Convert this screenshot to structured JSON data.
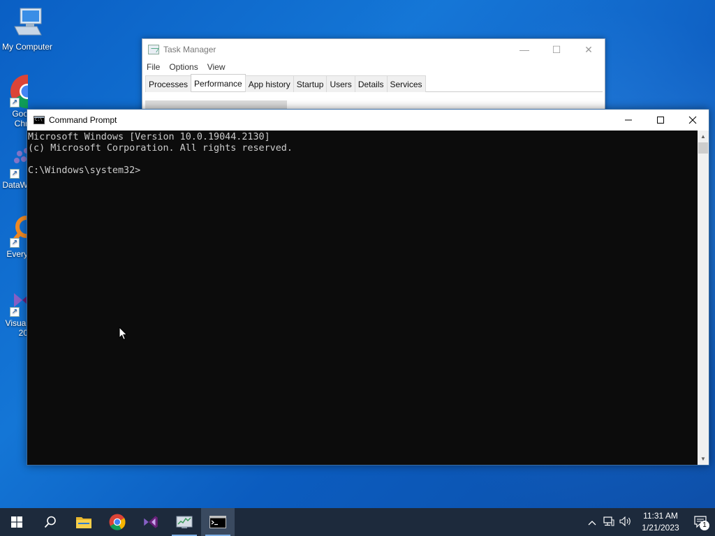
{
  "desktop": {
    "icons": [
      {
        "label": "My Computer"
      },
      {
        "label": "Goo\nChr"
      },
      {
        "label": "DataW"
      },
      {
        "label": "Every"
      },
      {
        "label": "Visual\n20"
      }
    ]
  },
  "task_manager": {
    "title": "Task Manager",
    "menu": [
      "File",
      "Options",
      "View"
    ],
    "tabs": [
      "Processes",
      "Performance",
      "App history",
      "Startup",
      "Users",
      "Details",
      "Services"
    ],
    "active_tab": "Performance",
    "controls": {
      "minimize": "—",
      "maximize": "☐",
      "close": "✕"
    }
  },
  "cmd": {
    "title": "Command Prompt",
    "lines": [
      "Microsoft Windows [Version 10.0.19044.2130]",
      "(c) Microsoft Corporation. All rights reserved.",
      "",
      "C:\\Windows\\system32>"
    ]
  },
  "taskbar": {
    "clock_time": "11:31 AM",
    "clock_date": "1/21/2023",
    "notification_count": "1"
  },
  "colors": {
    "console_bg": "#0c0c0c",
    "console_fg": "#cccccc",
    "taskbar_bg": "#1d2a3c",
    "desktop_blue": "#0a5fc4"
  }
}
